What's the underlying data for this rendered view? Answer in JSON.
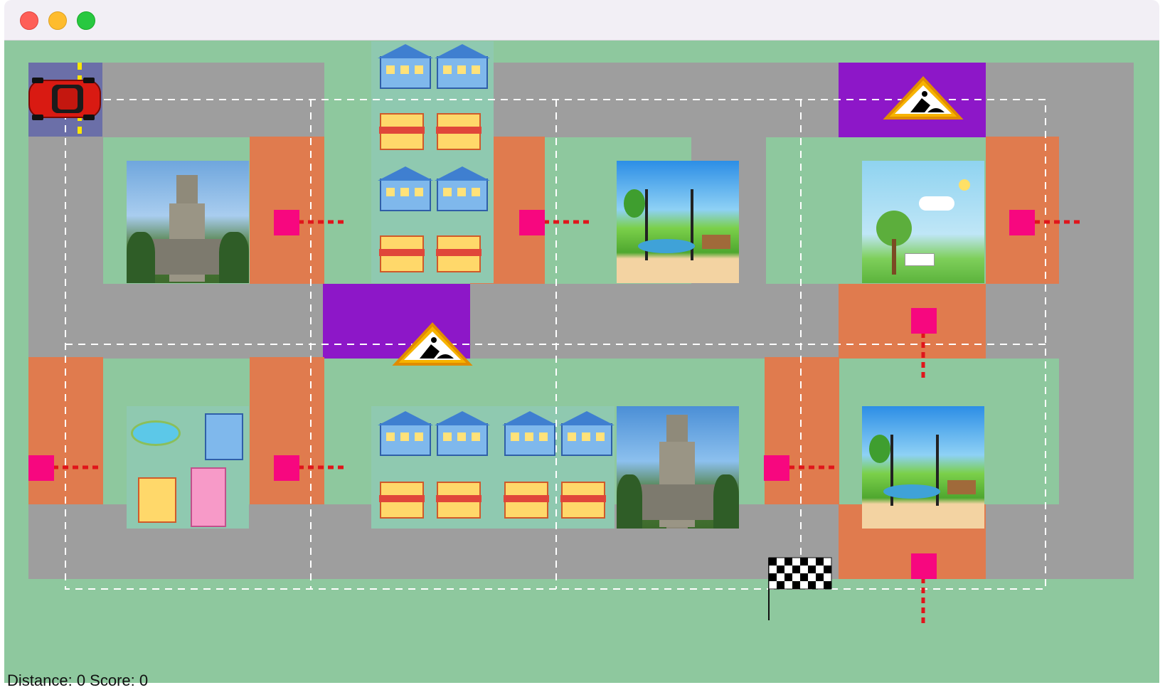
{
  "window": {
    "close_button": "close",
    "minimize_button": "minimize",
    "zoom_button": "zoom"
  },
  "icons": {
    "car": "red-car-icon",
    "roadwork": "road-work-sign-icon",
    "finish": "checkered-flag-icon",
    "traffic_light": "pedestrian-crossing-button-icon",
    "university": "university-tower-photo",
    "park": "city-park-picture",
    "shops": "shops-and-houses-icons",
    "fountain": "fountain-park-icon"
  },
  "colors": {
    "grass": "#8ec89e",
    "road": "#9e9e9e",
    "crosswalk": "#e07b4e",
    "road_work": "#8d17c8",
    "start": "#6b6fa8",
    "button": "#f7077f"
  },
  "status_line": "Distance: 0  Score: 0"
}
